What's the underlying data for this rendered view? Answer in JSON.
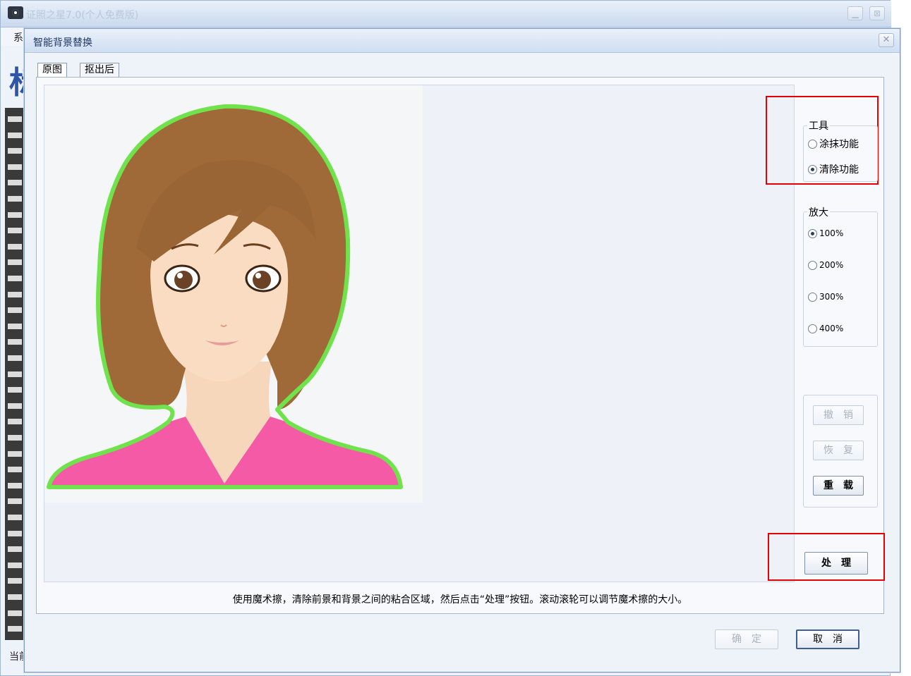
{
  "bg_window": {
    "title": "证照之星7.0(个人免费版)",
    "menu_label": "系",
    "logo_text": "标",
    "status_text": "当前",
    "minimize_icon": "minimize-icon",
    "maximize_icon": "maximize-icon"
  },
  "dialog": {
    "title": "智能背景替换",
    "close_label": "✕",
    "tabs": [
      {
        "label": "原图"
      },
      {
        "label": "抠出后"
      }
    ],
    "tools": {
      "title": "工具",
      "options": [
        {
          "label": "涂抹功能",
          "selected": false
        },
        {
          "label": "清除功能",
          "selected": true
        }
      ]
    },
    "zoom": {
      "title": "放大",
      "options": [
        {
          "label": "100%",
          "selected": true
        },
        {
          "label": "200%",
          "selected": false
        },
        {
          "label": "300%",
          "selected": false
        },
        {
          "label": "400%",
          "selected": false
        }
      ]
    },
    "buttons": {
      "undo": "撤　销",
      "redo": "恢　复",
      "reload": "重　载",
      "process": "处　理"
    },
    "hint": "使用魔术擦，清除前景和背景之间的粘合区域，然后点击“处理”按钮。滚动滚轮可以调节魔术擦的大小。",
    "ok_label": "确　定",
    "cancel_label": "取　消"
  },
  "colors": {
    "highlight": "#e60000",
    "outline_green": "#6fe24c",
    "hair": "#a06a38",
    "skin": "#f7d7bb",
    "shirt": "#f45aa6"
  }
}
